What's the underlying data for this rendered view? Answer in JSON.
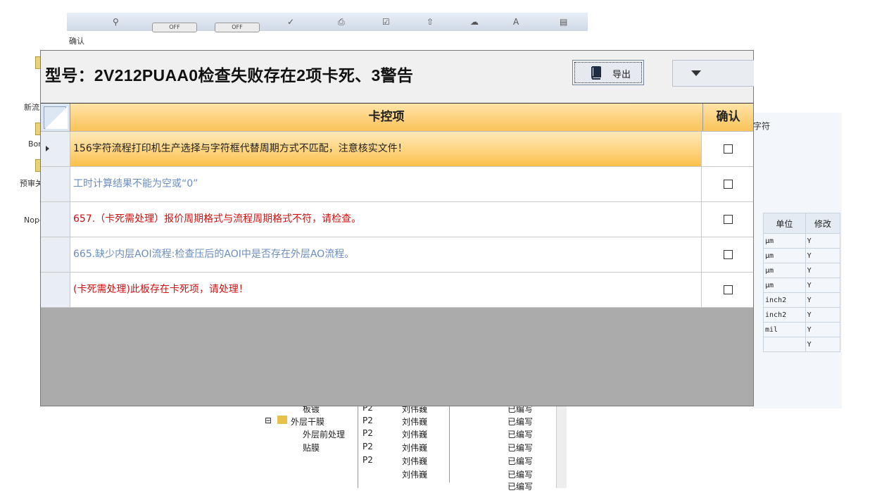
{
  "dialog": {
    "caption": "确认",
    "title": "型号：2V212PUAA0检查失败存在2项卡死、3警告",
    "export_label": "导出",
    "columns": {
      "item": "卡控项",
      "confirm": "确认"
    },
    "rows": [
      {
        "text": "156字符流程打印机生产选择与字符框代替周期方式不匹配，注意核实文件！",
        "color": "#222222",
        "checked": false,
        "active": true
      },
      {
        "text": "工时计算结果不能为空或“0”",
        "color": "#6b8cc0",
        "checked": false,
        "active": false
      },
      {
        "text": "657.（卡死需处理）报价周期格式与流程周期格式不符，请检查。",
        "color": "#d01010",
        "checked": false,
        "active": false
      },
      {
        "text": "665.缺少内层AOI流程:检查压后的AOI中是否存在外层AO流程。",
        "color": "#6b8cc0",
        "checked": false,
        "active": false
      },
      {
        "text": "(卡死需处理)此板存在卡死项，请处理！",
        "color": "#d01010",
        "checked": false,
        "active": false
      }
    ]
  },
  "background": {
    "toolbar_toggles": [
      "OFF",
      "OFF"
    ],
    "left_labels": [
      "新流",
      "Bom",
      "预审关",
      "Nope"
    ],
    "right_grid": {
      "headers": [
        "单位",
        "修改"
      ],
      "rows": [
        [
          "μm",
          "Y"
        ],
        [
          "μm",
          "Y"
        ],
        [
          "μm",
          "Y"
        ],
        [
          "μm",
          "Y"
        ],
        [
          "inch2",
          "Y"
        ],
        [
          "inch2",
          "Y"
        ],
        [
          "mil",
          "Y"
        ],
        [
          "",
          "Y"
        ]
      ],
      "side_label": "字符"
    },
    "tree": [
      {
        "label": "板镀",
        "code": "P2",
        "user": "刘伟巍",
        "status": "已编写"
      },
      {
        "label": "外层干膜",
        "code": "P2",
        "user": "刘伟巍",
        "status": "已编写"
      },
      {
        "label": "外层前处理",
        "code": "P2",
        "user": "刘伟巍",
        "status": "已编写"
      },
      {
        "label": "贴膜",
        "code": "P2",
        "user": "刘伟巍",
        "status": "已编写"
      },
      {
        "label": "",
        "code": "P2",
        "user": "刘伟巍",
        "status": "已编写"
      },
      {
        "label": "",
        "code": "",
        "user": "刘伟巍",
        "status": "已编写"
      },
      {
        "label": "",
        "code": "",
        "user": "",
        "status": "已编写"
      }
    ]
  }
}
